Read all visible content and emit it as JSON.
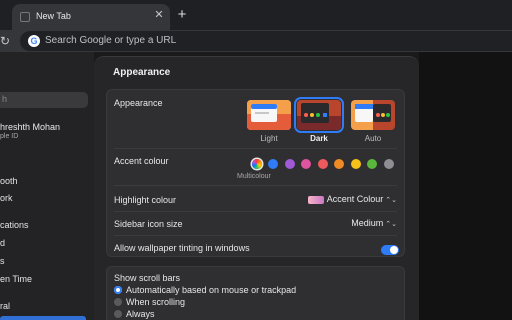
{
  "browser": {
    "tab_title": "New Tab",
    "tab_close": "✕",
    "new_tab": "+",
    "reload": "↻",
    "omnibox_placeholder": "Search Google or type a URL",
    "google_glyph": "G"
  },
  "sidebar": {
    "search_placeholder": "h",
    "user_name": "hreshth Mohan",
    "user_subtitle": "ple ID",
    "items": [
      {
        "label": "ooth"
      },
      {
        "label": "ork"
      },
      {
        "label": "cations"
      },
      {
        "label": "d"
      },
      {
        "label": "s"
      },
      {
        "label": "en Time"
      },
      {
        "label": "ral"
      }
    ]
  },
  "settings": {
    "title": "Appearance",
    "appearance": {
      "label": "Appearance",
      "options": [
        {
          "label": "Light",
          "selected": false
        },
        {
          "label": "Dark",
          "selected": true
        },
        {
          "label": "Auto",
          "selected": false
        }
      ]
    },
    "accent": {
      "label": "Accent colour",
      "multicolour_label": "Multicolour",
      "swatches": [
        "#2f7cf6",
        "#a05ad6",
        "#e0539f",
        "#f05a5f",
        "#f08a24",
        "#f5c21b",
        "#5ab83d",
        "#8e8e93"
      ]
    },
    "highlight": {
      "label": "Highlight colour",
      "value": "Accent Colour"
    },
    "sidebar_icon_size": {
      "label": "Sidebar icon size",
      "value": "Medium"
    },
    "wallpaper_tinting": {
      "label": "Allow wallpaper tinting in windows",
      "enabled": true
    },
    "scroll_bars": {
      "label": "Show scroll bars",
      "options": [
        {
          "label": "Automatically based on mouse or trackpad",
          "selected": true
        },
        {
          "label": "When scrolling",
          "selected": false
        },
        {
          "label": "Always",
          "selected": false
        }
      ]
    },
    "stepper_glyph": "⌃⌄"
  },
  "colors": {
    "accent": "#2f7cf6",
    "window_bg": "#262628",
    "group_bg": "#2f2f31"
  }
}
